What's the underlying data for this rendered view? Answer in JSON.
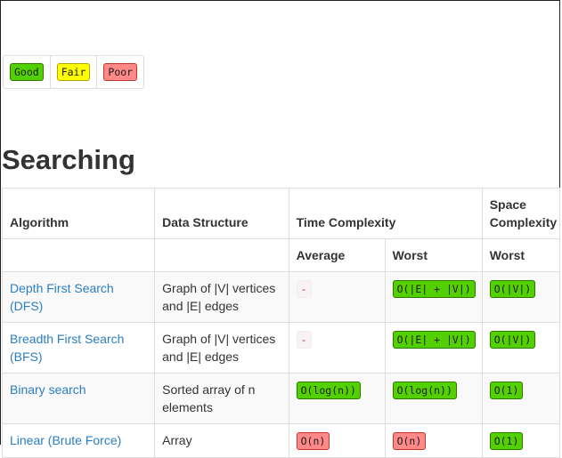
{
  "legend": {
    "good": "Good",
    "fair": "Fair",
    "poor": "Poor"
  },
  "section": {
    "title": "Searching"
  },
  "table": {
    "headers": {
      "algorithm": "Algorithm",
      "data_structure": "Data Structure",
      "time_complexity": "Time Complexity",
      "space_complexity": "Space Complexity",
      "average": "Average",
      "worst": "Worst",
      "space_worst": "Worst"
    },
    "rows": [
      {
        "algorithm": "Depth First Search (DFS)",
        "data_structure": "Graph of |V| vertices and |E| edges",
        "average": "-",
        "worst": "O(|E| + |V|)",
        "space": "O(|V|)"
      },
      {
        "algorithm": "Breadth First Search (BFS)",
        "data_structure": "Graph of |V| vertices and |E| edges",
        "average": "-",
        "worst": "O(|E| + |V|)",
        "space": "O(|V|)"
      },
      {
        "algorithm": "Binary search",
        "data_structure": "Sorted array of n elements",
        "average": "O(log(n))",
        "worst": "O(log(n))",
        "space": "O(1)"
      },
      {
        "algorithm": "Linear (Brute Force)",
        "data_structure": "Array",
        "average": "O(n)",
        "worst": "O(n)",
        "space": "O(1)"
      }
    ]
  },
  "colors": {
    "good": "#53d000",
    "fair": "#ffff00",
    "poor": "#ff8989",
    "link": "#2a7ec0"
  }
}
